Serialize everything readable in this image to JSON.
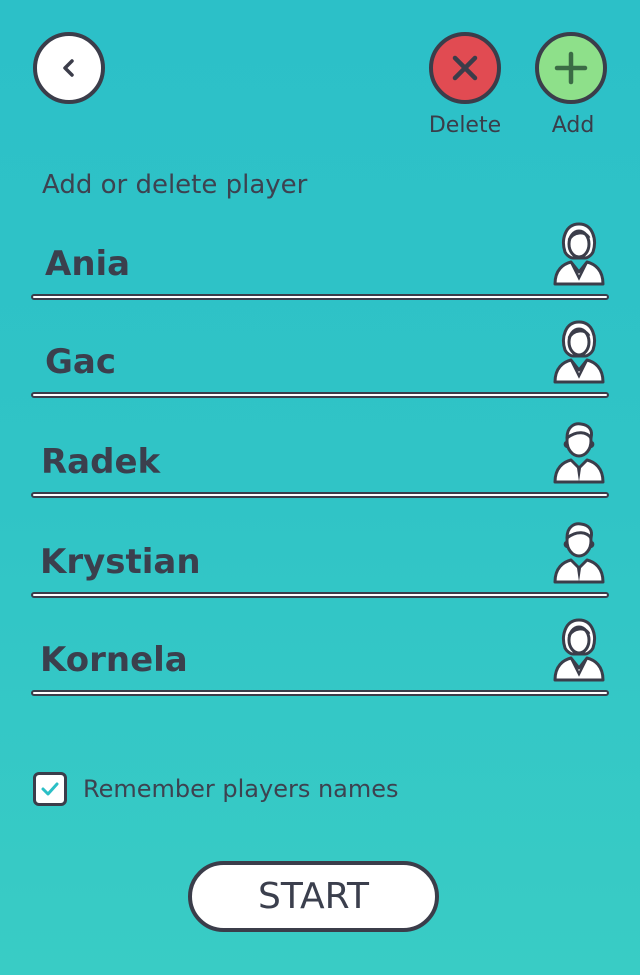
{
  "header": {
    "back_icon": "chevron-left-icon",
    "delete_icon": "close-icon",
    "add_icon": "plus-icon",
    "delete_label": "Delete",
    "add_label": "Add",
    "colors": {
      "delete": "#e14b52",
      "add": "#8ee08a",
      "outline": "#3b3d4a"
    }
  },
  "section_title": "Add or delete player",
  "players": [
    {
      "name": "Ania",
      "avatar": "female-avatar-icon"
    },
    {
      "name": "Gac",
      "avatar": "female-avatar-icon"
    },
    {
      "name": "Radek",
      "avatar": "male-avatar-icon"
    },
    {
      "name": "Krystian",
      "avatar": "male-avatar-icon"
    },
    {
      "name": "Kornela",
      "avatar": "female-avatar-icon"
    }
  ],
  "remember": {
    "label": "Remember players names",
    "checked": true,
    "check_color": "#2cbfc6"
  },
  "start_label": "START"
}
